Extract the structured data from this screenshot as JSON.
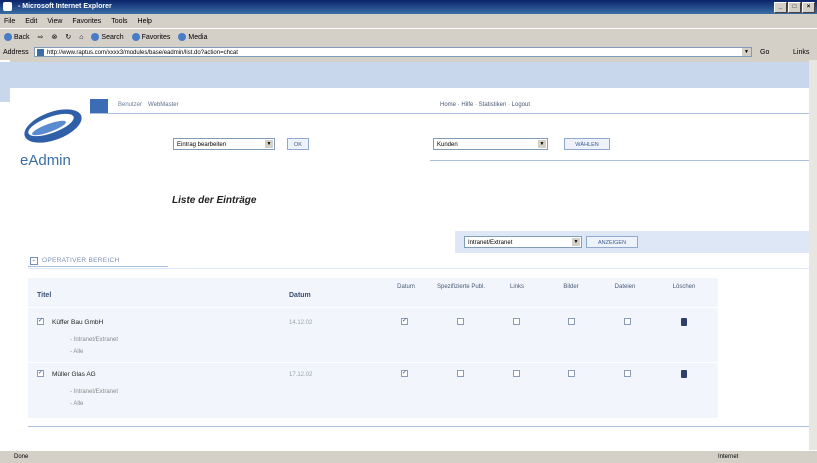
{
  "window": {
    "title": " - Microsoft Internet Explorer",
    "controls": [
      "_",
      "□",
      "×"
    ]
  },
  "menu": [
    "File",
    "Edit",
    "View",
    "Favorites",
    "Tools",
    "Help"
  ],
  "toolbar": {
    "back": "Back",
    "search": "Search",
    "favorites": "Favorites",
    "media": "Media"
  },
  "address": {
    "label": "Address",
    "url": "http://www.raptus.com/xxxx3/modules/base/eadmin/list.do?action=chcat",
    "go": "Go",
    "links": "Links"
  },
  "nav": {
    "user_label": "Benutzer",
    "user_name": "WebMaster",
    "links": "Home · Hilfe · Statistiken · Logout"
  },
  "logo": {
    "text": "eAdmin"
  },
  "controls": {
    "action_select": "Eintrag bearbeiten",
    "ok_button": "OK",
    "category_select": "Kunden",
    "choose_button": "WÄHLEN",
    "filter_select": "Intranet/Extranet",
    "show_button": "ANZEIGEN"
  },
  "page_title": "Liste der Einträge",
  "section": {
    "plus": "+",
    "label": "OPERATIVER BEREICH"
  },
  "table": {
    "headers": {
      "title": "Titel",
      "date": "Datum",
      "datum": "Datum",
      "spec": "Spezifizierte Publ.",
      "links": "Links",
      "images": "Bilder",
      "files": "Dateien",
      "delete": "Löschen"
    },
    "rows": [
      {
        "title": "Küffer Bau GmbH",
        "date": "14.12.02",
        "sub1": "- Intranet/Extranet",
        "sub2": "- Alle",
        "checked": "✓"
      },
      {
        "title": "Müller Glas AG",
        "date": "17.12.02",
        "sub1": "- Intranet/Extranet",
        "sub2": "- Alle",
        "checked": "✓"
      }
    ]
  },
  "status": {
    "left": "Done",
    "right": "Internet"
  }
}
